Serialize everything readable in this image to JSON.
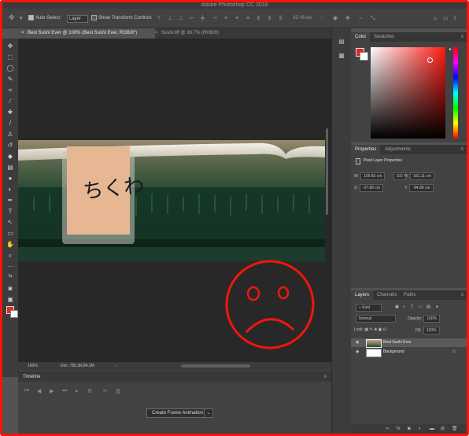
{
  "window": {
    "title": "Adobe Photoshop CC 2018"
  },
  "options_bar": {
    "auto_select_label": "Auto-Select:",
    "auto_select_target": "Layer",
    "show_transform_label": "Show Transform Controls",
    "mode_3d_label": "3D Mode:"
  },
  "tabs": [
    {
      "label": "Best Sushi Ever @ 100% (Best Sushi Ever, RGB/8*)",
      "active": true
    },
    {
      "label": "Sushi.tiff @ 16.7% (RGB/8)",
      "active": false
    }
  ],
  "canvas": {
    "photo_text": "ちくわ"
  },
  "status_bar": {
    "zoom": "100%",
    "doc": "Doc: 785.3K/34.3M"
  },
  "timeline": {
    "tab": "Timeline",
    "create_button": "Create Frame Animation"
  },
  "color_panel": {
    "tabs": [
      "Color",
      "Swatches"
    ],
    "foreground_color": "#e8261d",
    "background_color": "#ffffff"
  },
  "properties_panel": {
    "tabs": [
      "Properties",
      "Adjustments"
    ],
    "section_title": "Pixel Layer Properties",
    "w_label": "W:",
    "w_value": "105.83 cm",
    "link_label": "GO",
    "h_label": "H:",
    "h_value": "161.11 cm",
    "x_label": "X:",
    "x_value": "-37.89 cm",
    "y_label": "Y:",
    "y_value": "-94.89 cm"
  },
  "layers_panel": {
    "tabs": [
      "Layers",
      "Channels",
      "Paths"
    ],
    "kind_filter": "Kind",
    "blend_mode": "Normal",
    "opacity_label": "Opacity:",
    "opacity_value": "100%",
    "lock_label": "Lock:",
    "fill_label": "Fill:",
    "fill_value": "100%",
    "layers": [
      {
        "name": "Best Sushi Ever",
        "selected": true
      },
      {
        "name": "Background",
        "selected": false
      }
    ]
  },
  "annotation": {
    "shape": "sad-face",
    "color": "#f2160b"
  }
}
